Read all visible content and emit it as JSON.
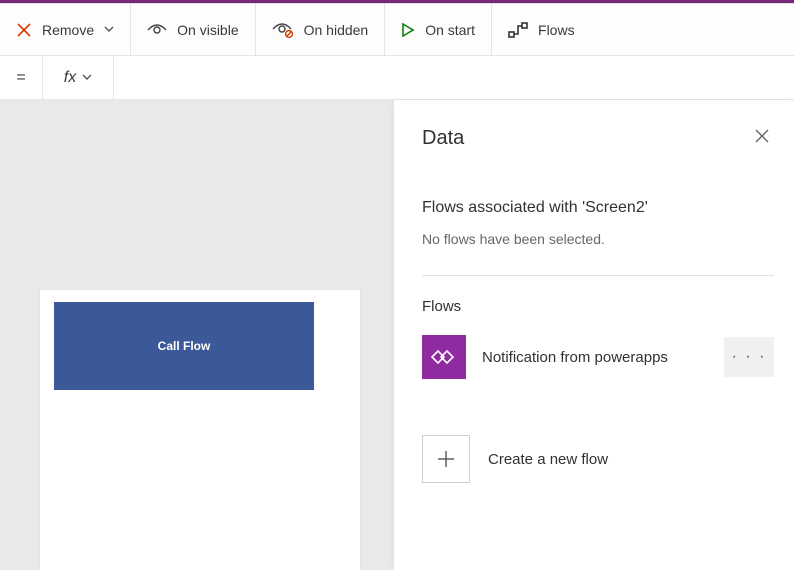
{
  "toolbar": {
    "remove": "Remove",
    "on_visible": "On visible",
    "on_hidden": "On hidden",
    "on_start": "On start",
    "flows": "Flows"
  },
  "formula_bar": {
    "equals": "=",
    "fx": "fx"
  },
  "canvas": {
    "call_flow_button": "Call Flow"
  },
  "panel": {
    "title": "Data",
    "associated_title": "Flows associated with 'Screen2'",
    "associated_empty": "No flows have been selected.",
    "flows_label": "Flows",
    "flow_item_name": "Notification from powerapps",
    "more_dots": "· · ·",
    "create_label": "Create a new flow"
  }
}
